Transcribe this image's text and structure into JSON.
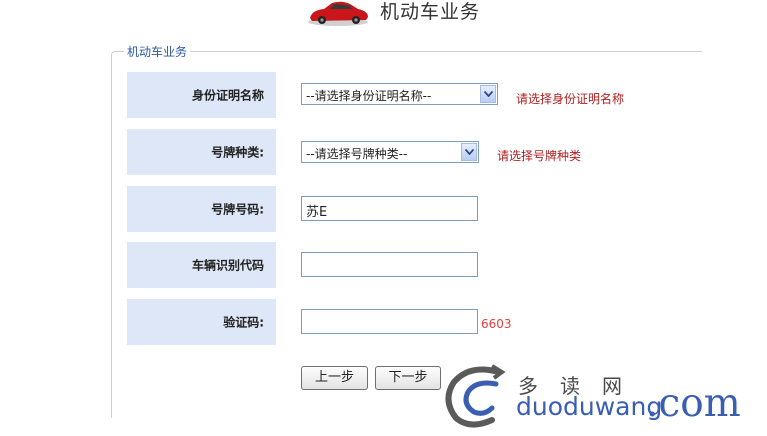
{
  "header": {
    "title": "机动车业务"
  },
  "form": {
    "legend": "机动车业务",
    "id_doc_label": "身份证明名称",
    "id_doc_select": "--请选择身份证明名称--",
    "id_doc_hint": "请选择身份证明名称",
    "plate_type_label": "号牌种类:",
    "plate_type_select": "--请选择号牌种类--",
    "plate_type_hint": "请选择号牌种类",
    "plate_no_label": "号牌号码:",
    "plate_no_value": "苏E",
    "vin_label": "车辆识别代码",
    "vin_value": "",
    "captcha_label": "验证码:",
    "captcha_value": "",
    "captcha_code": "6603"
  },
  "buttons": {
    "prev": "上一步",
    "next": "下一步"
  },
  "watermark": {
    "cn": "多读网",
    "domain": "duoduwang",
    "tld": ".com"
  },
  "colors": {
    "label_bg": "#dde7f7",
    "hint": "#b02020",
    "captcha": "#e0403e",
    "accent": "#2a57a8"
  }
}
